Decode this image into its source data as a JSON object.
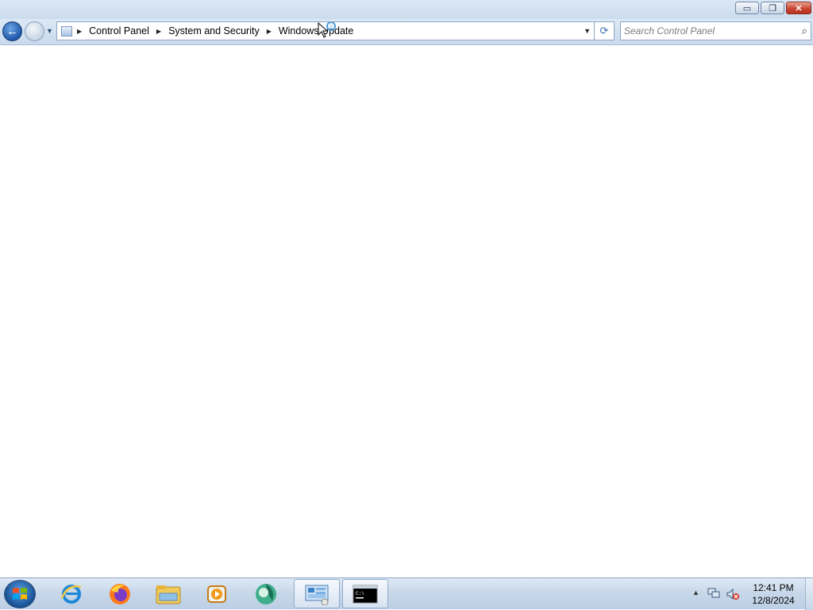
{
  "window": {
    "minimize_glyph": "▭",
    "restore_glyph": "❐",
    "close_glyph": "✕"
  },
  "navigation": {
    "back_glyph": "←",
    "recent_glyph": "▼",
    "breadcrumb_separator": "▶",
    "breadcrumbs": [
      "Control Panel",
      "System and Security",
      "Windows Update"
    ],
    "dropdown_glyph": "▼",
    "refresh_glyph": "⟳"
  },
  "search": {
    "placeholder": "Search Control Panel",
    "icon_glyph": "⌕"
  },
  "taskbar": {
    "items": [
      "start-orb-icon",
      "internet-explorer-icon",
      "firefox-icon",
      "file-explorer-icon",
      "media-player-icon",
      "app-globe-icon",
      "control-panel-icon",
      "command-prompt-icon"
    ],
    "active_items": [
      "control-panel-icon"
    ]
  },
  "tray": {
    "show_hidden_glyph": "▲",
    "time": "12:41 PM",
    "date": "12/8/2024",
    "volume_status": "muted"
  },
  "colors": {
    "accent": "#1d57a8",
    "close_button": "#c7412f"
  }
}
